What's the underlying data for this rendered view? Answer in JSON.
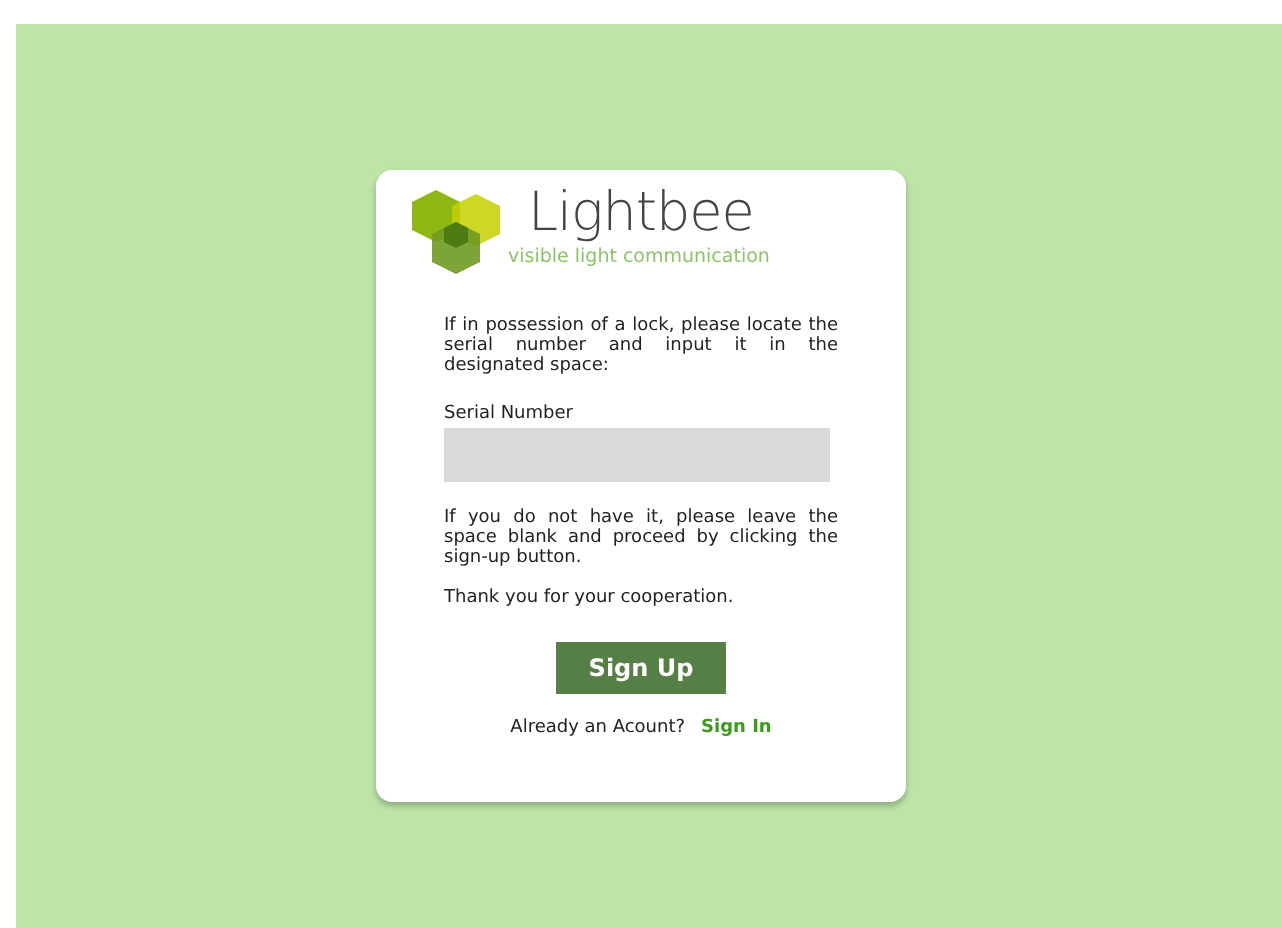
{
  "logo": {
    "name": "Lightbee",
    "tagline": "visible light communication"
  },
  "intro": "If in possession of a lock, please locate the serial number and input it in the designated space:",
  "serial_field": {
    "label": "Serial Number"
  },
  "note": "If you do not have it, please leave the space blank and proceed by clicking the sign-up button.",
  "thanks": "Thank you for your cooperation.",
  "signup_button": "Sign Up",
  "signin": {
    "prompt": "Already an Acount?",
    "link": "Sign In"
  }
}
